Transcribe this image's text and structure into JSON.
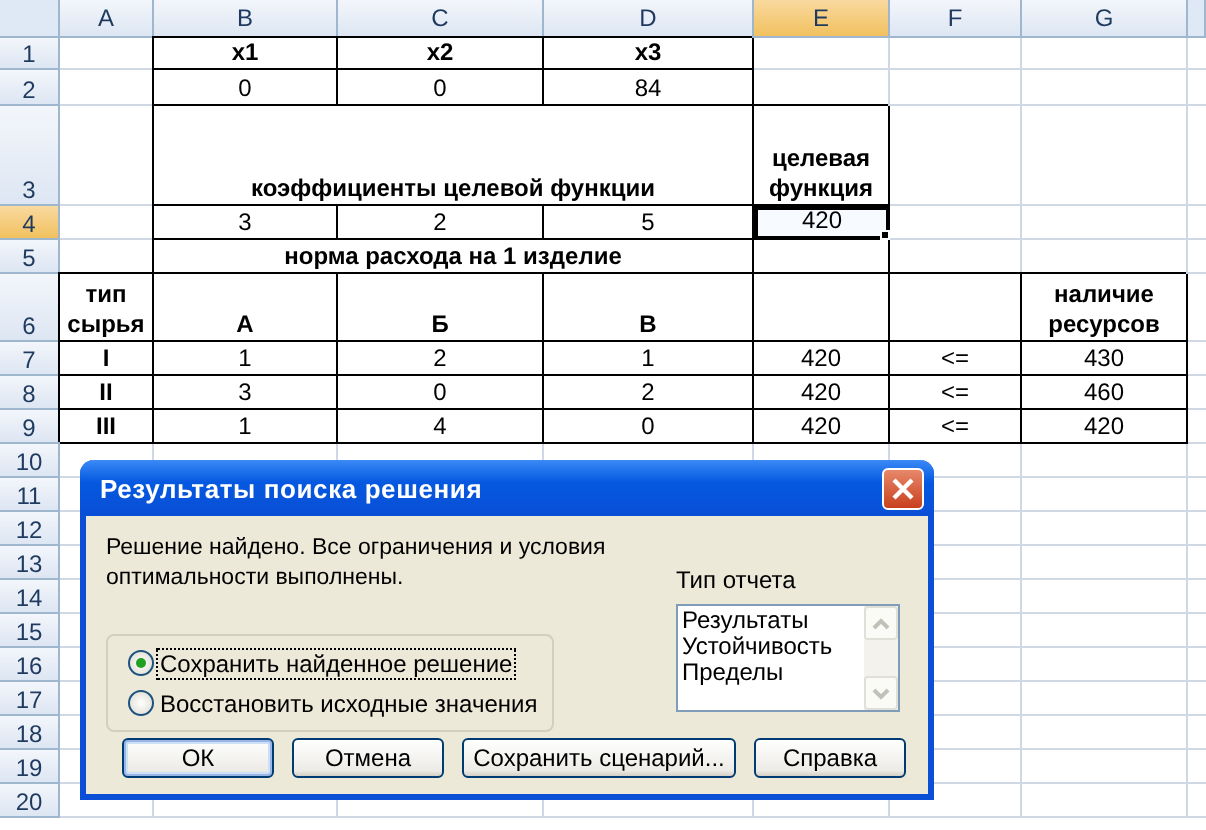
{
  "columns": [
    {
      "label": "A",
      "selected": false
    },
    {
      "label": "B",
      "selected": false
    },
    {
      "label": "C",
      "selected": false
    },
    {
      "label": "D",
      "selected": false
    },
    {
      "label": "E",
      "selected": true
    },
    {
      "label": "F",
      "selected": false
    },
    {
      "label": "G",
      "selected": false
    }
  ],
  "rows": [
    {
      "number": "1",
      "selected": false,
      "cells": [
        null,
        {
          "text": "x1",
          "bold": true,
          "selected": false
        },
        {
          "text": "x2",
          "bold": true,
          "selected": false
        },
        {
          "text": "x3",
          "bold": true,
          "selected": false
        },
        null,
        null,
        null
      ]
    },
    {
      "number": "2",
      "selected": false,
      "cells": [
        null,
        {
          "text": "0",
          "bold": false,
          "selected": false
        },
        {
          "text": "0",
          "bold": false,
          "selected": false
        },
        {
          "text": "84",
          "bold": false,
          "selected": false
        },
        null,
        null,
        null
      ]
    },
    {
      "number": "3",
      "selected": false,
      "cells": [
        null,
        {
          "text": "коэффициенты целевой функции",
          "bold": true,
          "selected": false,
          "kind": "wide"
        },
        {
          "text": "целевая функция",
          "bold": true,
          "selected": false
        },
        null,
        null
      ]
    },
    {
      "number": "4",
      "selected": true,
      "cells": [
        null,
        {
          "text": "3",
          "bold": false,
          "selected": false
        },
        {
          "text": "2",
          "bold": false,
          "selected": false
        },
        {
          "text": "5",
          "bold": false,
          "selected": false
        },
        {
          "text": "420",
          "bold": false,
          "selected": true
        },
        null,
        null
      ]
    },
    {
      "number": "5",
      "selected": false,
      "cells": [
        null,
        {
          "text": "норма расхода на 1 изделие",
          "bold": true,
          "selected": false,
          "kind": "wide"
        },
        null,
        null,
        null
      ]
    },
    {
      "number": "6",
      "selected": false,
      "cells": [
        {
          "text": "тип сырья",
          "bold": true,
          "selected": false
        },
        {
          "text": "А",
          "bold": true,
          "selected": false
        },
        {
          "text": "Б",
          "bold": true,
          "selected": false
        },
        {
          "text": "В",
          "bold": true,
          "selected": false
        },
        null,
        null,
        {
          "text": "наличие ресурсов",
          "bold": true,
          "selected": false
        }
      ]
    },
    {
      "number": "7",
      "selected": false,
      "cells": [
        {
          "text": "I",
          "bold": true,
          "selected": false
        },
        {
          "text": "1",
          "bold": false,
          "selected": false
        },
        {
          "text": "2",
          "bold": false,
          "selected": false
        },
        {
          "text": "1",
          "bold": false,
          "selected": false
        },
        {
          "text": "420",
          "bold": false,
          "selected": false
        },
        {
          "text": "<=",
          "bold": false,
          "selected": false
        },
        {
          "text": "430",
          "bold": false,
          "selected": false
        }
      ]
    },
    {
      "number": "8",
      "selected": false,
      "cells": [
        {
          "text": "II",
          "bold": true,
          "selected": false
        },
        {
          "text": "3",
          "bold": false,
          "selected": false
        },
        {
          "text": "0",
          "bold": false,
          "selected": false
        },
        {
          "text": "2",
          "bold": false,
          "selected": false
        },
        {
          "text": "420",
          "bold": false,
          "selected": false
        },
        {
          "text": "<=",
          "bold": false,
          "selected": false
        },
        {
          "text": "460",
          "bold": false,
          "selected": false
        }
      ]
    },
    {
      "number": "9",
      "selected": false,
      "cells": [
        {
          "text": "III",
          "bold": true,
          "selected": false
        },
        {
          "text": "1",
          "bold": false,
          "selected": false
        },
        {
          "text": "4",
          "bold": false,
          "selected": false
        },
        {
          "text": "0",
          "bold": false,
          "selected": false
        },
        {
          "text": "420",
          "bold": false,
          "selected": false
        },
        {
          "text": "<=",
          "bold": false,
          "selected": false
        },
        {
          "text": "420",
          "bold": false,
          "selected": false
        }
      ]
    },
    {
      "number": "10",
      "selected": false
    },
    {
      "number": "11",
      "selected": false
    },
    {
      "number": "12",
      "selected": false
    },
    {
      "number": "13",
      "selected": false
    },
    {
      "number": "14",
      "selected": false
    },
    {
      "number": "15",
      "selected": false
    },
    {
      "number": "16",
      "selected": false
    },
    {
      "number": "17",
      "selected": false
    },
    {
      "number": "18",
      "selected": false
    },
    {
      "number": "19",
      "selected": false
    },
    {
      "number": "20",
      "selected": false
    }
  ],
  "dialog": {
    "title": "Результаты поиска решения",
    "message": "Решение найдено. Все ограничения и условия оптимальности выполнены.",
    "options": [
      {
        "label": "Сохранить найденное решение",
        "selected": true
      },
      {
        "label": "Восстановить исходные значения",
        "selected": false
      }
    ],
    "report_type": {
      "label": "Тип отчета",
      "items": [
        "Результаты",
        "Устойчивость",
        "Пределы"
      ]
    },
    "buttons": [
      {
        "label": "ОК",
        "default": true
      },
      {
        "label": "Отмена",
        "default": false
      },
      {
        "label": "Сохранить сценарий...",
        "default": false
      },
      {
        "label": "Справка",
        "default": false
      }
    ]
  }
}
